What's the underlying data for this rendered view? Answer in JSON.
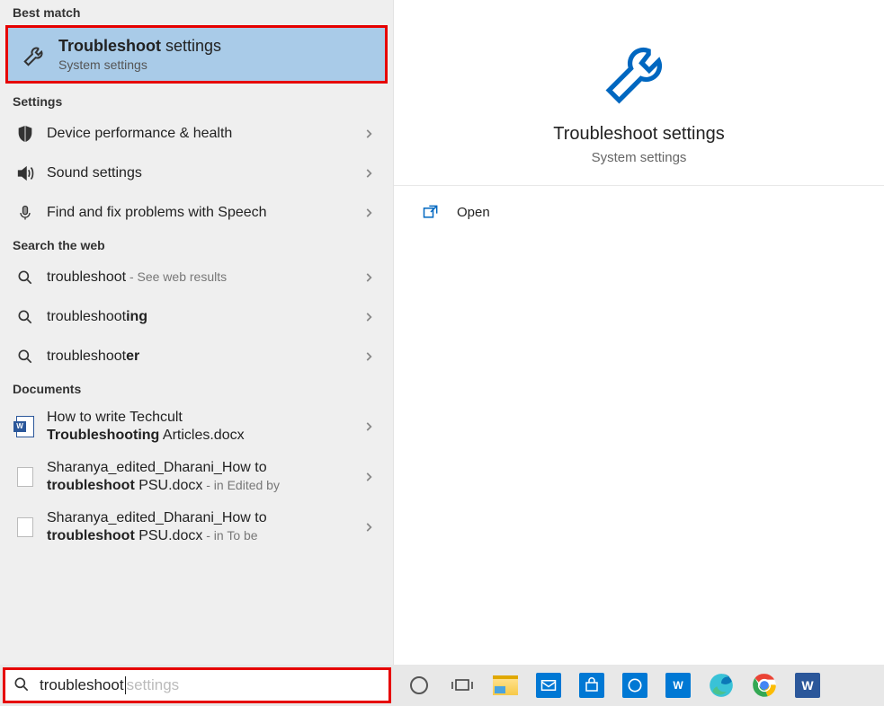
{
  "sections": {
    "best_match": "Best match",
    "settings": "Settings",
    "search_web": "Search the web",
    "documents": "Documents"
  },
  "best_match": {
    "title_bold": "Troubleshoot",
    "title_rest": " settings",
    "subtitle": "System settings"
  },
  "settings_items": [
    {
      "icon": "shield-icon",
      "text": "Device performance & health"
    },
    {
      "icon": "sound-icon",
      "text": "Sound settings"
    },
    {
      "icon": "mic-icon",
      "text": "Find and fix problems with Speech"
    }
  ],
  "web_items": [
    {
      "prefix": "troubleshoot",
      "suffix": "",
      "meta": " - See web results"
    },
    {
      "prefix": "troubleshoot",
      "suffix": "ing",
      "meta": ""
    },
    {
      "prefix": "troubleshoot",
      "suffix": "er",
      "meta": ""
    }
  ],
  "documents_items": [
    {
      "line1_plain_pre": "How to write Techcult ",
      "line1_bold": "",
      "line2_bold": "Troubleshooting",
      "line2_plain": " Articles.docx",
      "meta": ""
    },
    {
      "line1_plain_pre": "Sharanya_edited_Dharani_How to ",
      "line1_bold": "",
      "line2_bold": "troubleshoot",
      "line2_plain": " PSU.docx",
      "meta": " - in Edited by"
    },
    {
      "line1_plain_pre": "Sharanya_edited_Dharani_How to ",
      "line1_bold": "",
      "line2_bold": "troubleshoot",
      "line2_plain": " PSU.docx",
      "meta": " - in To be"
    }
  ],
  "preview": {
    "title": "Troubleshoot settings",
    "subtitle": "System settings",
    "action_label": "Open"
  },
  "search": {
    "typed": "troubleshoot",
    "ghost": " settings"
  },
  "taskbar": {
    "icons": [
      "cortana",
      "taskview",
      "explorer",
      "mail",
      "store",
      "dell",
      "word-online",
      "edge",
      "chrome",
      "word"
    ]
  }
}
